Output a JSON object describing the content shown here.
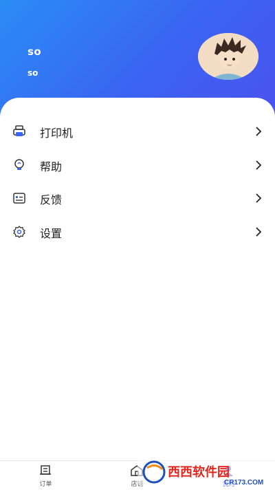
{
  "profile": {
    "name": "so",
    "subtitle": "so"
  },
  "menu": {
    "items": [
      {
        "label": "打印机",
        "icon": "printer-icon"
      },
      {
        "label": "帮助",
        "icon": "help-icon"
      },
      {
        "label": "反馈",
        "icon": "feedback-icon"
      },
      {
        "label": "设置",
        "icon": "settings-icon"
      }
    ]
  },
  "tabs": [
    {
      "label": "订单",
      "icon": "order-icon"
    },
    {
      "label": "店铺",
      "icon": "store-icon"
    },
    {
      "label": "我的",
      "icon": "profile-icon",
      "active": true
    }
  ],
  "watermark": {
    "brand": "西西软件园",
    "url": "CR173.COM"
  },
  "colors": {
    "header_start": "#2a8df5",
    "header_end": "#4b52ee",
    "accent": "#3a64f2"
  }
}
